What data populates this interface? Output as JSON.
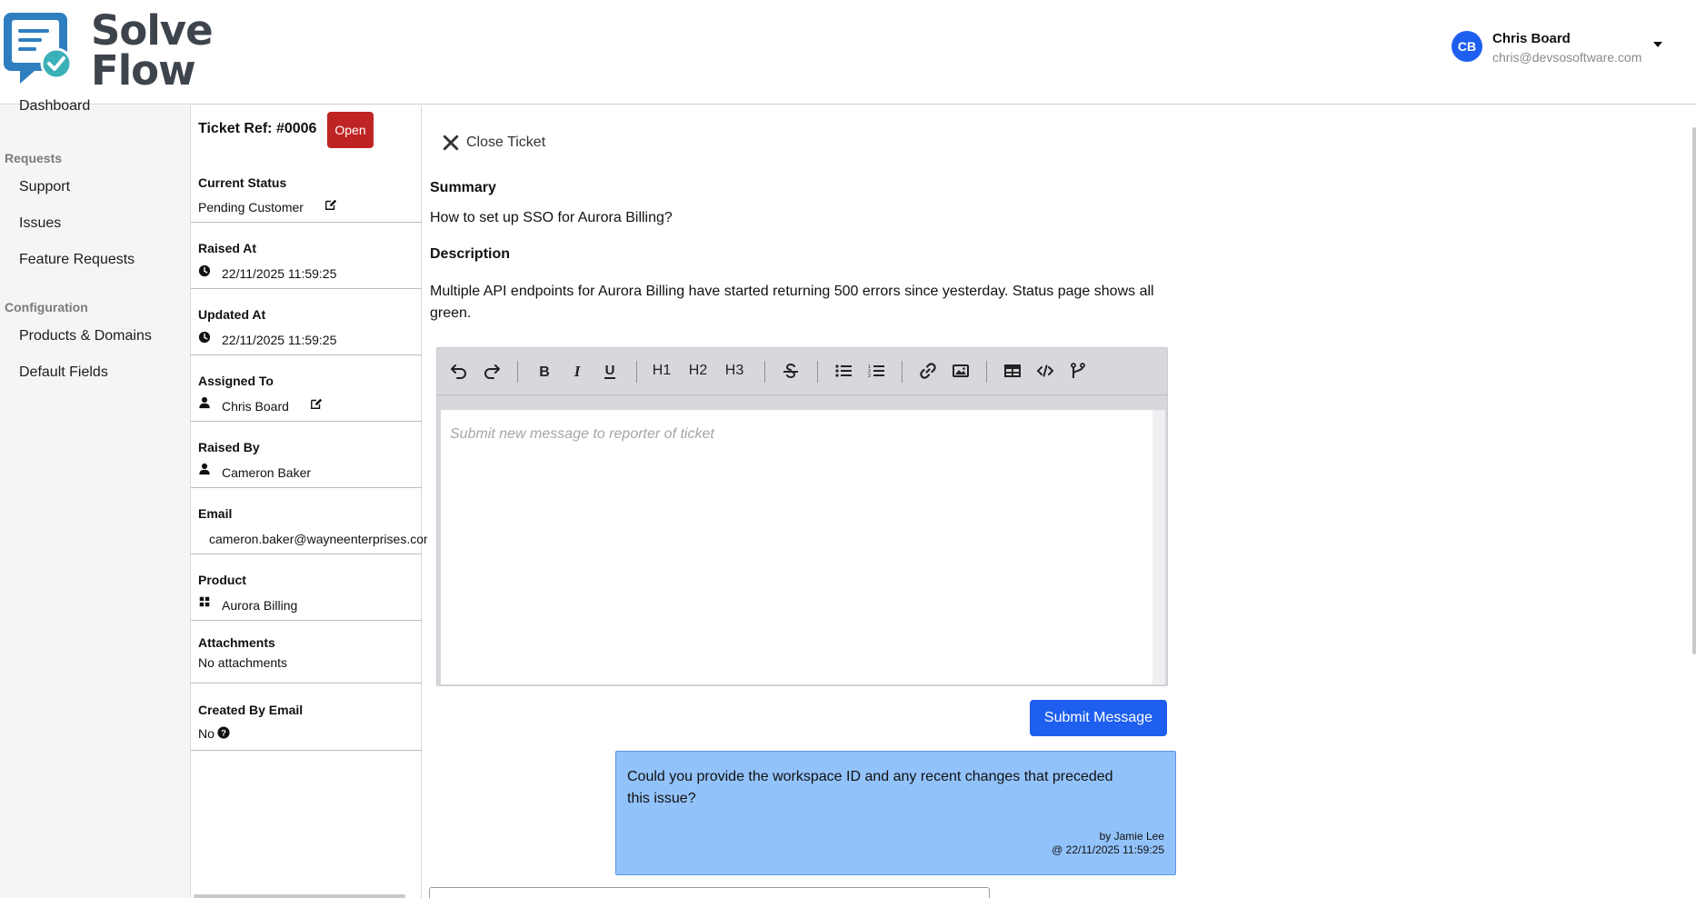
{
  "brand": {
    "name_line1": "Solve",
    "name_line2": "Flow",
    "primary_color": "#1e5ff0",
    "logo_color": "#2f7ec0",
    "check_color": "#3ab0b8"
  },
  "user": {
    "initials": "CB",
    "name": "Chris Board",
    "email": "chris@devsosoftware.com"
  },
  "nav": {
    "dashboard": "Dashboard",
    "requests_group": "Requests",
    "support": "Support",
    "issues": "Issues",
    "feature_requests": "Feature Requests",
    "configuration_group": "Configuration",
    "products_domains": "Products & Domains",
    "default_fields": "Default Fields"
  },
  "ticket": {
    "ref": "Ticket Ref: #0006",
    "status_badge": "Open",
    "status_badge_color": "#bf2424",
    "current_status_label": "Current Status",
    "current_status": "Pending Customer",
    "raised_at_label": "Raised At",
    "raised_at": "22/11/2025 11:59:25",
    "updated_at_label": "Updated At",
    "updated_at": "22/11/2025 11:59:25",
    "assigned_to_label": "Assigned To",
    "assigned_to": "Chris Board",
    "raised_by_label": "Raised By",
    "raised_by": "Cameron Baker",
    "email_label": "Email",
    "email": "cameron.baker@wayneenterprises.com",
    "product_label": "Product",
    "product": "Aurora Billing",
    "attachments_label": "Attachments",
    "attachments": "No attachments",
    "created_by_email_label": "Created By Email",
    "created_by_email": "No"
  },
  "main": {
    "close_ticket": "Close Ticket",
    "summary_label": "Summary",
    "summary": "How to set up SSO for Aurora Billing?",
    "description_label": "Description",
    "description": "Multiple API endpoints for Aurora Billing have started returning 500 errors since yesterday. Status page shows all green.",
    "editor_placeholder": "Submit new message to reporter of ticket",
    "toolbar": {
      "h1": "H1",
      "h2": "H2",
      "h3": "H3"
    },
    "submit_label": "Submit Message"
  },
  "messages": [
    {
      "text": "Could you provide the workspace ID and any recent changes that preceded this issue?",
      "by": "by Jamie Lee",
      "at": "@ 22/11/2025 11:59:25",
      "bubble_color": "#92c2fa"
    }
  ]
}
